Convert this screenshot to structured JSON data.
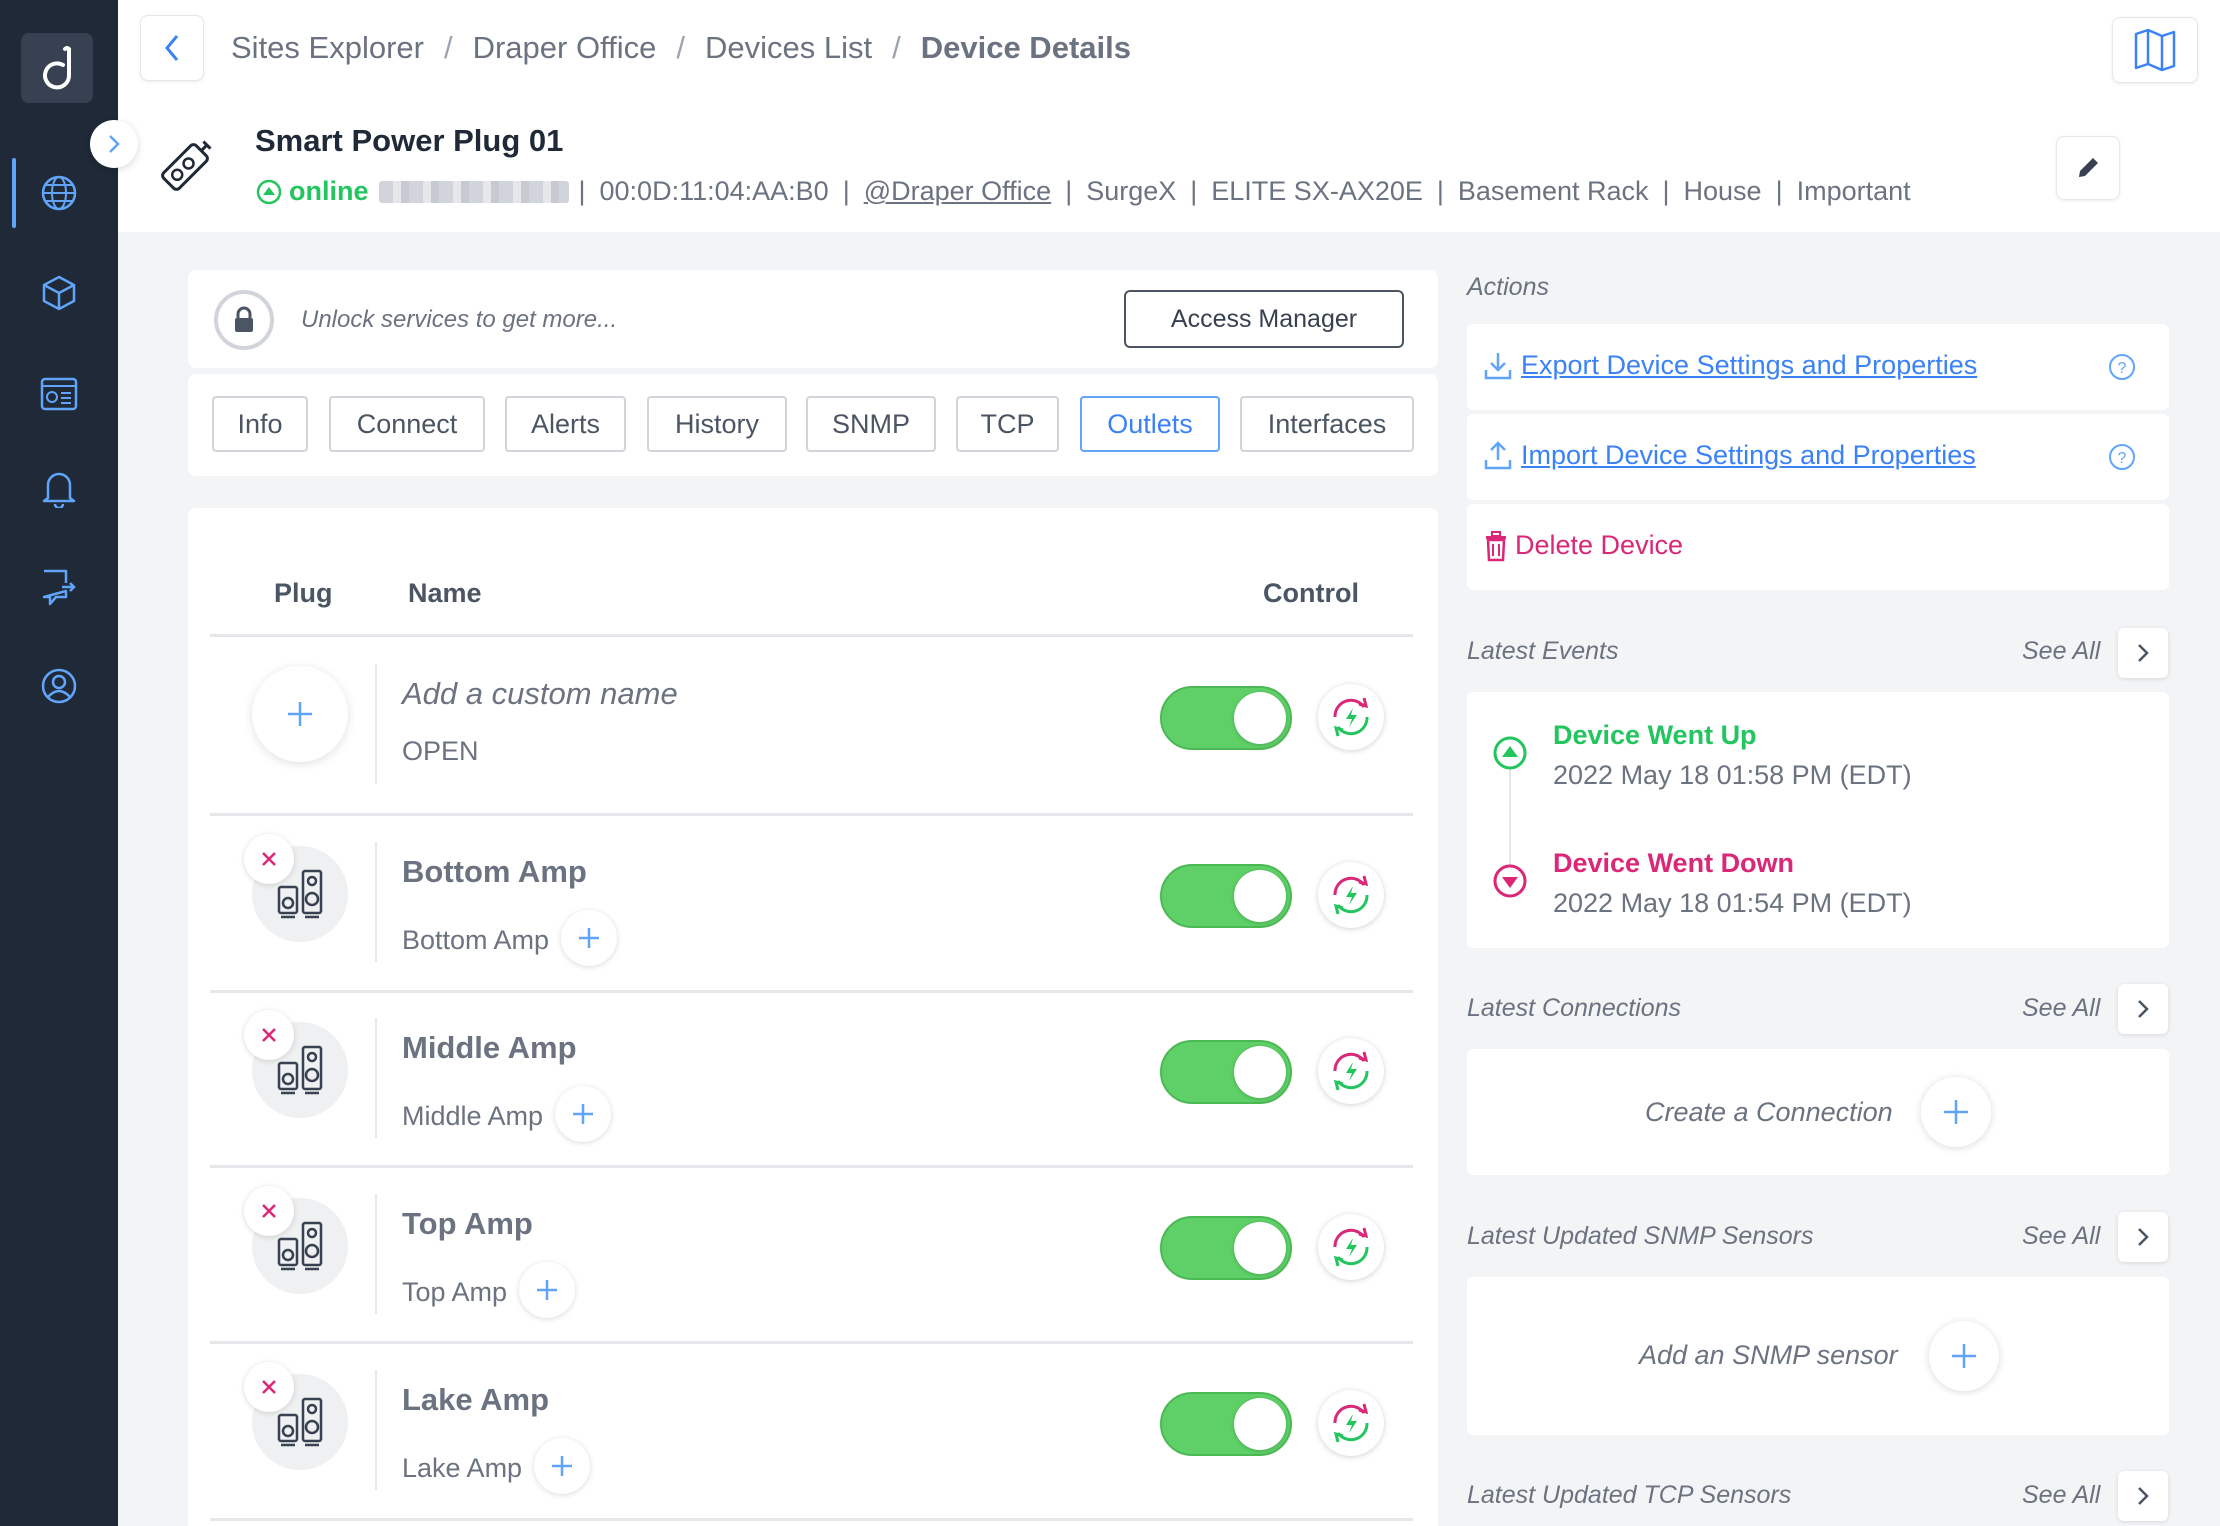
{
  "breadcrumb": {
    "items": [
      "Sites Explorer",
      "Draper Office",
      "Devices List"
    ],
    "separator": "/",
    "current": "Device Details"
  },
  "device": {
    "name": "Smart Power Plug 01",
    "status": "online",
    "mac": "00:0D:11:04:AA:B0",
    "site": "@Draper Office",
    "manufacturer": "SurgeX",
    "model": "ELITE SX-AX20E",
    "location": "Basement Rack",
    "tag1": "House",
    "tag2": "Important"
  },
  "unlock": {
    "text": "Unlock services to get more...",
    "button": "Access Manager"
  },
  "tabs": [
    "Info",
    "Connect",
    "Alerts",
    "History",
    "SNMP",
    "TCP",
    "Outlets",
    "Interfaces"
  ],
  "active_tab": "Outlets",
  "outlets": {
    "columns": {
      "plug": "Plug",
      "name": "Name",
      "control": "Control"
    },
    "rows": [
      {
        "title": "Add a custom name",
        "subtitle": "OPEN",
        "on": true
      },
      {
        "title": "Bottom Amp",
        "subtitle": "Bottom Amp",
        "on": true
      },
      {
        "title": "Middle Amp",
        "subtitle": "Middle Amp",
        "on": true
      },
      {
        "title": "Top Amp",
        "subtitle": "Top Amp",
        "on": true
      },
      {
        "title": "Lake Amp",
        "subtitle": "Lake Amp",
        "on": true
      }
    ]
  },
  "actions": {
    "label": "Actions",
    "export": "Export Device Settings and Properties",
    "import": "Import Device Settings and Properties",
    "delete": "Delete Device"
  },
  "events": {
    "label": "Latest Events",
    "see_all": "See All",
    "items": [
      {
        "title": "Device Went Up",
        "date": "2022 May 18 01:58 PM (EDT)"
      },
      {
        "title": "Device Went Down",
        "date": "2022 May 18 01:54 PM (EDT)"
      }
    ]
  },
  "connections": {
    "label": "Latest Connections",
    "see_all": "See All",
    "create": "Create a Connection"
  },
  "snmp": {
    "label": "Latest Updated SNMP Sensors",
    "see_all": "See All",
    "add": "Add an SNMP sensor"
  },
  "tcp": {
    "label": "Latest Updated TCP Sensors",
    "see_all": "See All"
  },
  "colors": {
    "sidebar": "#1f2937",
    "accent": "#3b82f6",
    "online": "#22c55e",
    "danger": "#db2777",
    "toggle_on": "#5fd068"
  },
  "icons": {
    "logo": "domotz-logo-icon",
    "nav": [
      "globe-icon",
      "cube-icon",
      "dashboard-icon",
      "bell-icon",
      "integration-icon",
      "support-icon"
    ]
  }
}
